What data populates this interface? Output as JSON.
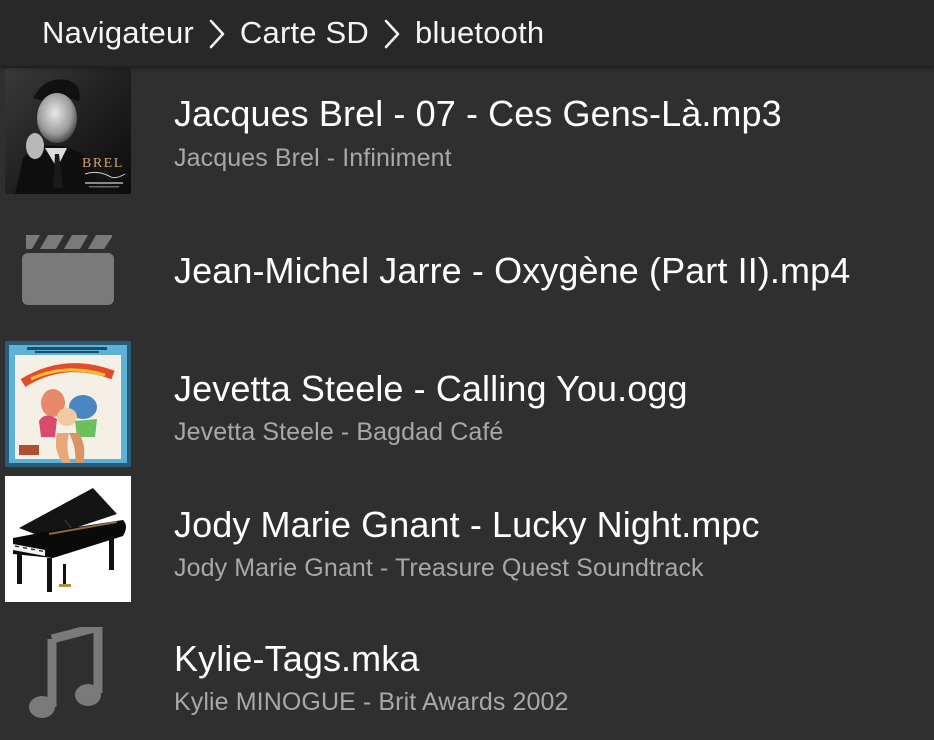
{
  "breadcrumb": {
    "items": [
      "Navigateur",
      "Carte SD",
      "bluetooth"
    ]
  },
  "files": [
    {
      "title": "Jacques Brel - 07 - Ces Gens-Là.mp3",
      "subtitle": "Jacques Brel - Infiniment",
      "thumb": "album-art-brel",
      "cover_text": "BREL"
    },
    {
      "title": "Jean-Michel Jarre - Oxygène (Part II).mp4",
      "subtitle": "",
      "thumb": "video-icon"
    },
    {
      "title": "Jevetta Steele - Calling You.ogg",
      "subtitle": "Jevetta Steele - Bagdad Café",
      "thumb": "album-art-bagdad-cafe"
    },
    {
      "title": "Jody Marie Gnant - Lucky Night.mpc",
      "subtitle": "Jody Marie Gnant - Treasure Quest Soundtrack",
      "thumb": "album-art-piano"
    },
    {
      "title": "Kylie-Tags.mka",
      "subtitle": "Kylie MINOGUE - Brit Awards 2002",
      "thumb": "music-note-icon"
    }
  ],
  "colors": {
    "background": "#2f2f2f",
    "header": "#282828",
    "title_text": "#ffffff",
    "subtitle_text": "#a8a8a8",
    "icon_gray": "#7a7a7a"
  }
}
